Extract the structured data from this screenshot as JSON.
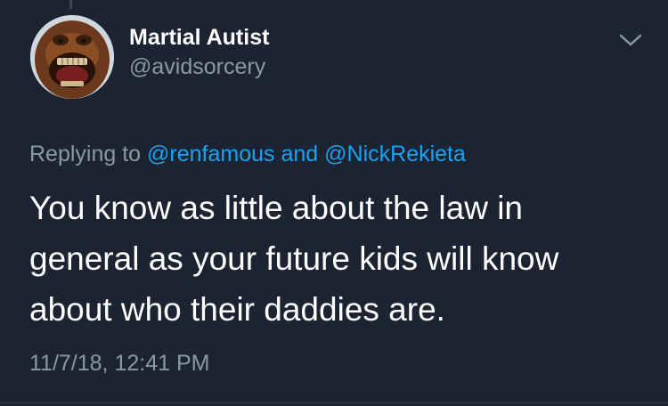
{
  "user": {
    "display_name": "Martial Autist",
    "handle": "@avidsorcery"
  },
  "reply": {
    "prefix": "Replying to",
    "mention_1": "@renfamous",
    "conjunction": "and",
    "mention_2": "@NickRekieta"
  },
  "tweet": {
    "lines": [
      "You know as little about the law in",
      "general as your future kids will know",
      "about who their daddies are."
    ]
  },
  "timestamp": "11/7/18, 12:41 PM",
  "icons": {
    "menu": "chevron-down-icon",
    "avatar": "laughing-orangutan"
  },
  "colors": {
    "background": "#1c2431",
    "link": "#1da1f2",
    "secondary_text": "#8899a6",
    "primary_text": "#ffffff"
  }
}
